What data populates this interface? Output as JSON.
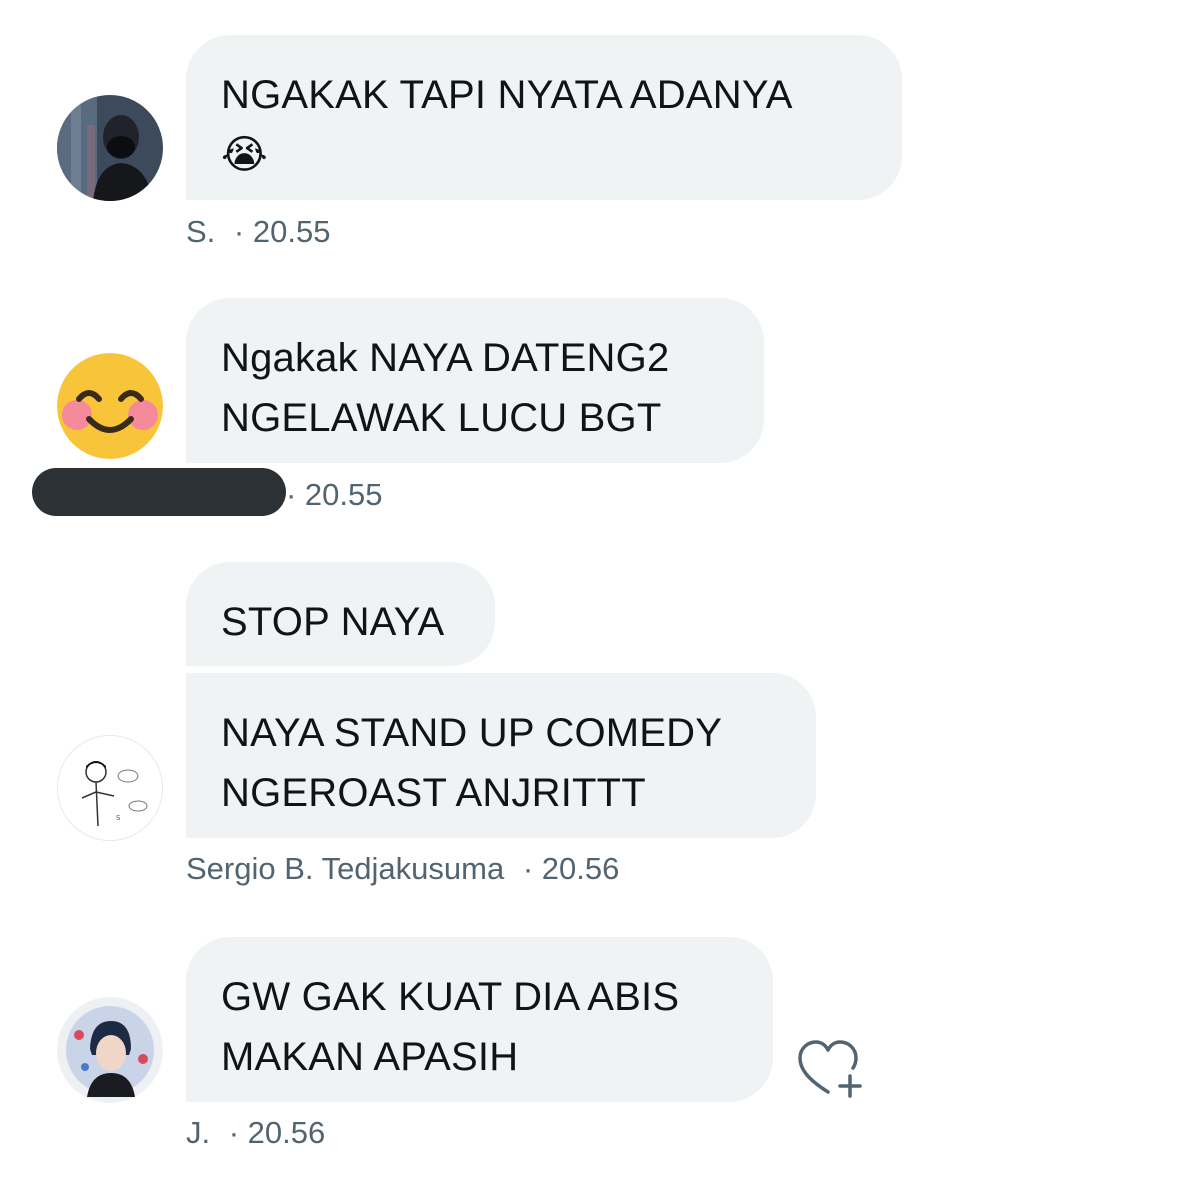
{
  "messages": [
    {
      "lines": [
        "NGAKAK TAPI NYATA ADANYA",
        "😭"
      ],
      "avatar": "profile-photo-black-mask",
      "sender": "S.",
      "time": "· 20.55"
    },
    {
      "lines": [
        "Ngakak NAYA DATENG2",
        "NGELAWAK LUCU BGT"
      ],
      "avatar": "smiling-blush-emoji",
      "sender": "",
      "time": "· 20.55"
    },
    {
      "lines": [
        "STOP NAYA"
      ],
      "sender": "",
      "time": ""
    },
    {
      "lines": [
        "NAYA STAND UP COMEDY",
        "NGEROAST ANJRITTT"
      ],
      "avatar": "stick-figure-doodle",
      "sender": "Sergio B. Tedjakusuma",
      "time": "· 20.56"
    },
    {
      "lines": [
        "GW GAK KUAT DIA ABIS",
        "MAKAN APASIH"
      ],
      "avatar": "profile-photo-person",
      "sender": "J.",
      "time": "· 20.56"
    }
  ],
  "icons": {
    "add_reaction": "heart-plus-icon"
  },
  "colors": {
    "bubble": "#eff3f4",
    "meta_text": "#536471",
    "redaction": "#2c3135",
    "text": "#0f1419"
  }
}
